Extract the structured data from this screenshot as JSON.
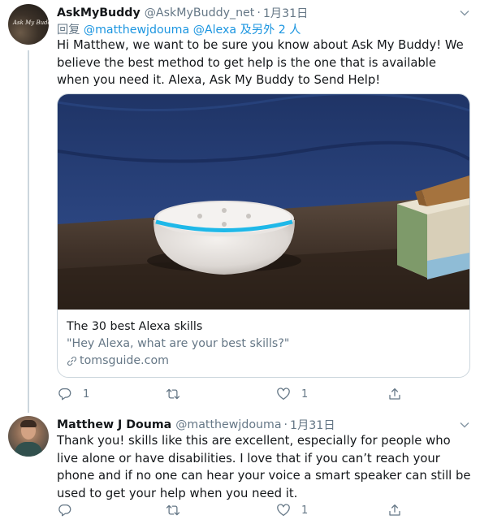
{
  "tweet1": {
    "display_name": "AskMyBuddy",
    "handle": "@AskMyBuddy_net",
    "separator": "·",
    "date": "1月31日",
    "avatar_text": "Ask My Buddy",
    "reply_prefix": "回复",
    "reply_mention1": "@matthewjdouma",
    "reply_mention2": "@Alexa",
    "reply_suffix": "及另外 2 人",
    "text": "Hi Matthew, we want to be sure you know about Ask My Buddy!  We believe the best method to get help is the one that is available when you need it. Alexa, Ask My Buddy to Send Help!",
    "card": {
      "title": "The 30 best Alexa skills",
      "description": "\"Hey Alexa, what are your best skills?\"",
      "domain": "tomsguide.com",
      "image_icon": "echo-dot-smart-speaker-photo"
    },
    "actions": {
      "reply_count": "1",
      "retweet_count": "",
      "like_count": "1"
    }
  },
  "tweet2": {
    "display_name": "Matthew J Douma",
    "handle": "@matthewjdouma",
    "separator": "·",
    "date": "1月31日",
    "text": "Thank you! skills like this are excellent, especially for people who live alone or have disabilities. I love that if you can’t reach your phone and if no one can hear your voice a smart speaker can still be used to get your help when you need it.",
    "actions": {
      "reply_count": "",
      "retweet_count": "",
      "like_count": "1"
    }
  },
  "icons": [
    "reply-icon",
    "retweet-icon",
    "like-icon",
    "share-icon",
    "chevron-down-icon",
    "link-icon"
  ],
  "colors": {
    "text": "#14171a",
    "secondary": "#657786",
    "link": "#1b95e0",
    "border": "#ccd6dd",
    "echo_ring": "#1fb8e8"
  }
}
